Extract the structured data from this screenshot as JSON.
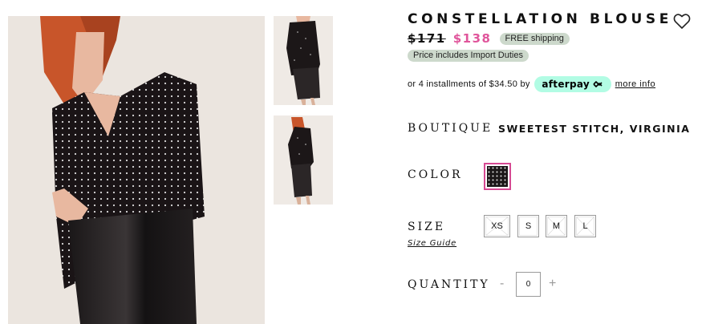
{
  "product": {
    "title": "CONSTELLATION BLOUSE",
    "original_price": "$171",
    "sale_price": "$138",
    "shipping_badge": "FREE shipping",
    "duties_badge": "Price includes Import Duties"
  },
  "installments": {
    "text": "or 4 installments of $34.50 by",
    "provider": "afterpay",
    "more_info": "more info"
  },
  "boutique": {
    "label": "BOUTIQUE",
    "value": "SWEETEST STITCH, VIRGINIA"
  },
  "color": {
    "label": "COLOR"
  },
  "size": {
    "label": "SIZE",
    "guide": "Size Guide",
    "options": [
      "XS",
      "S",
      "M",
      "L"
    ]
  },
  "quantity": {
    "label": "QUANTITY",
    "minus": "-",
    "plus": "+",
    "value": "0"
  },
  "colors": {
    "accent_pink": "#e0559b",
    "badge_green": "#cdd9cc",
    "afterpay_mint": "#b2fce4",
    "swatch_border": "#d64a93"
  },
  "icons": {
    "wishlist": "heart-outline-icon",
    "afterpay": "afterpay-loop-icon"
  }
}
